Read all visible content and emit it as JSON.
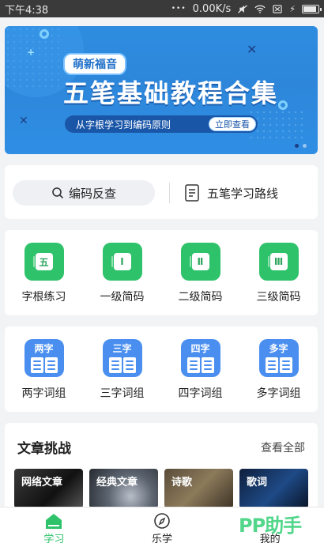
{
  "status_bar": {
    "time": "下午4:38",
    "speed": "0.00K/s",
    "battery_level": 0.9
  },
  "banner": {
    "tag": "萌新福音",
    "title": "五笔基础教程合集",
    "subtitle": "从字根学习到编码原则",
    "cta": "立即查看"
  },
  "tools": {
    "search_label": "编码反查",
    "route_label": "五笔学习路线"
  },
  "practice": [
    {
      "glyph": "五",
      "label": "字根练习",
      "icon": "radical-practice-icon"
    },
    {
      "glyph": "Ⅰ",
      "label": "一级简码",
      "icon": "level-1-code-icon"
    },
    {
      "glyph": "Ⅱ",
      "label": "二级简码",
      "icon": "level-2-code-icon"
    },
    {
      "glyph": "Ⅲ",
      "label": "三级简码",
      "icon": "level-3-code-icon"
    }
  ],
  "phrases": [
    {
      "glyph": "两字",
      "label": "两字词组"
    },
    {
      "glyph": "三字",
      "label": "三字词组"
    },
    {
      "glyph": "四字",
      "label": "四字词组"
    },
    {
      "glyph": "多字",
      "label": "多字词组"
    }
  ],
  "articles": {
    "heading": "文章挑战",
    "more": "查看全部",
    "items": [
      "网络文章",
      "经典文章",
      "诗歌",
      "歌词"
    ]
  },
  "bottom_nav": [
    {
      "label": "学习",
      "icon": "home-icon"
    },
    {
      "label": "乐学",
      "icon": "compass-icon"
    },
    {
      "label": "我的",
      "icon": "profile-icon"
    }
  ],
  "watermark": "PP助手",
  "colors": {
    "accent_green": "#2ec26a",
    "accent_blue": "#4a8ff0",
    "banner_blue": "#2e8de0"
  }
}
